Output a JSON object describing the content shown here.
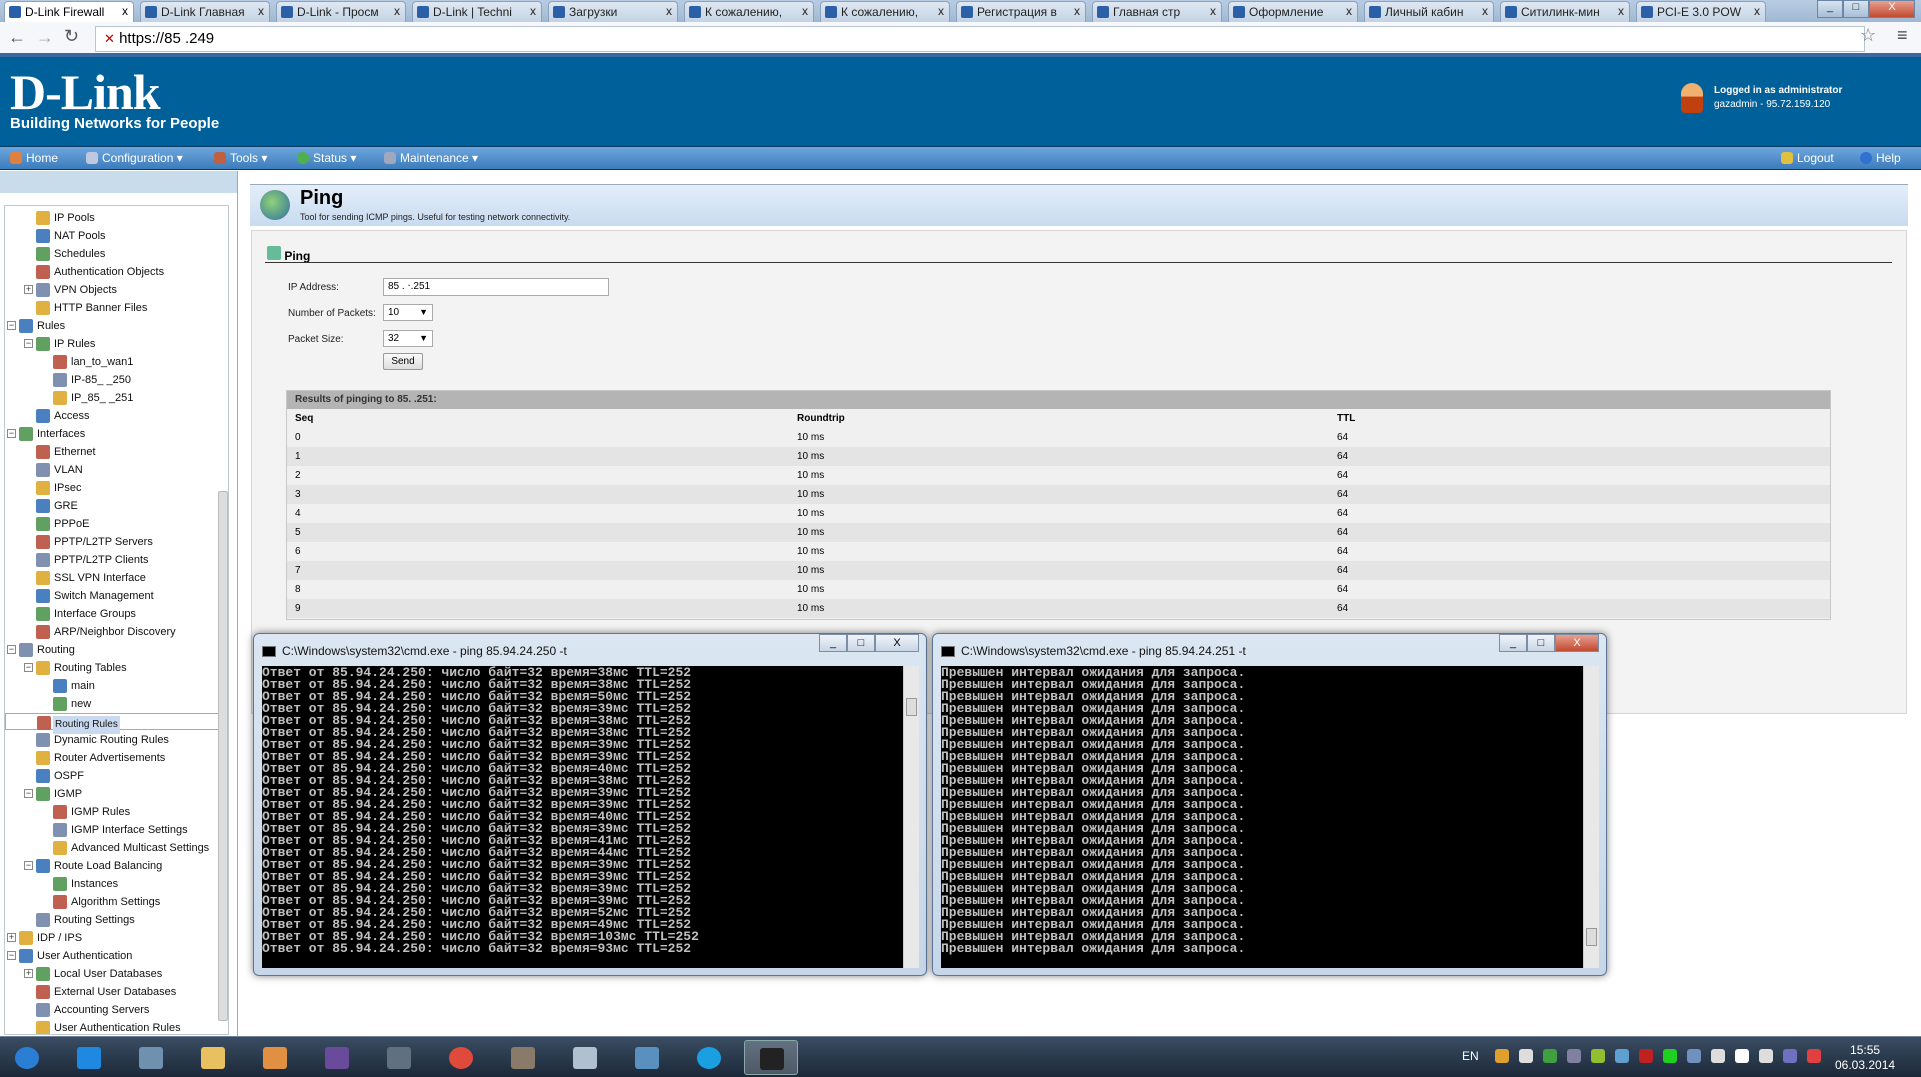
{
  "browser": {
    "tabs": [
      "D-Link Firewall",
      "D-Link Главная",
      "D-Link - Просм",
      "D-Link | Techni",
      "Загрузки",
      "К сожалению,",
      "К сожалению,",
      "Регистрация в",
      "Главная стр",
      "Оформление",
      "Личный кабин",
      "Ситилинк-мин",
      "PCI-E 3.0 POW"
    ],
    "tab_close": "x",
    "address": "https://85        .249",
    "window_controls": [
      "_",
      "□",
      "X"
    ]
  },
  "header": {
    "logo": "D-Link",
    "logo_tagline": "Building Networks for People",
    "logged_in": "Logged in as administrator",
    "user_line": "gazadmin - 95.72.159.120"
  },
  "nav": {
    "items": [
      "Home",
      "Configuration ▾",
      "Tools ▾",
      "Status ▾",
      "Maintenance ▾"
    ],
    "logout": "Logout",
    "help": "Help"
  },
  "sidebar": {
    "items": [
      {
        "label": "IP Pools",
        "level": 2
      },
      {
        "label": "NAT Pools",
        "level": 2
      },
      {
        "label": "Schedules",
        "level": 2
      },
      {
        "label": "Authentication Objects",
        "level": 2
      },
      {
        "label": "VPN Objects",
        "level": 2,
        "exp": "+"
      },
      {
        "label": "HTTP Banner Files",
        "level": 2
      },
      {
        "label": "Rules",
        "level": 1,
        "exp": "-"
      },
      {
        "label": "IP Rules",
        "level": 2,
        "exp": "-"
      },
      {
        "label": "lan_to_wan1",
        "level": 3
      },
      {
        "label": "IP-85_      _250",
        "level": 3
      },
      {
        "label": "IP_85_      _251",
        "level": 3
      },
      {
        "label": "Access",
        "level": 2
      },
      {
        "label": "Interfaces",
        "level": 1,
        "exp": "-"
      },
      {
        "label": "Ethernet",
        "level": 2
      },
      {
        "label": "VLAN",
        "level": 2
      },
      {
        "label": "IPsec",
        "level": 2
      },
      {
        "label": "GRE",
        "level": 2
      },
      {
        "label": "PPPoE",
        "level": 2
      },
      {
        "label": "PPTP/L2TP Servers",
        "level": 2
      },
      {
        "label": "PPTP/L2TP Clients",
        "level": 2
      },
      {
        "label": "SSL VPN Interface",
        "level": 2
      },
      {
        "label": "Switch Management",
        "level": 2
      },
      {
        "label": "Interface Groups",
        "level": 2
      },
      {
        "label": "ARP/Neighbor Discovery",
        "level": 2
      },
      {
        "label": "Routing",
        "level": 1,
        "exp": "-"
      },
      {
        "label": "Routing Tables",
        "level": 2,
        "exp": "-"
      },
      {
        "label": "main",
        "level": 3
      },
      {
        "label": "new",
        "level": 3
      },
      {
        "label": "Routing Rules",
        "level": 2,
        "selected": true
      },
      {
        "label": "Dynamic Routing Rules",
        "level": 2
      },
      {
        "label": "Router Advertisements",
        "level": 2
      },
      {
        "label": "OSPF",
        "level": 2
      },
      {
        "label": "IGMP",
        "level": 2,
        "exp": "-"
      },
      {
        "label": "IGMP Rules",
        "level": 3
      },
      {
        "label": "IGMP Interface Settings",
        "level": 3
      },
      {
        "label": "Advanced Multicast Settings",
        "level": 3
      },
      {
        "label": "Route Load Balancing",
        "level": 2,
        "exp": "-"
      },
      {
        "label": "Instances",
        "level": 3
      },
      {
        "label": "Algorithm Settings",
        "level": 3
      },
      {
        "label": "Routing Settings",
        "level": 2
      },
      {
        "label": "IDP / IPS",
        "level": 1,
        "exp": "+"
      },
      {
        "label": "User Authentication",
        "level": 1,
        "exp": "-"
      },
      {
        "label": "Local User Databases",
        "level": 2,
        "exp": "+"
      },
      {
        "label": "External User Databases",
        "level": 2
      },
      {
        "label": "Accounting Servers",
        "level": 2
      },
      {
        "label": "User Authentication Rules",
        "level": 2
      }
    ]
  },
  "page": {
    "title": "Ping",
    "description": "Tool for sending ICMP pings. Useful for testing network connectivity.",
    "section": "Ping",
    "ip_label": "IP Address:",
    "ip_value": "85    .    ‧.251",
    "packets_label": "Number of Packets:",
    "packets_value": "10",
    "size_label": "Packet Size:",
    "size_value": "32",
    "send": "Send",
    "arrow": "▼",
    "results_title": "Results of pinging to 85.        .251:",
    "columns": [
      "Seq",
      "Roundtrip",
      "TTL"
    ],
    "rows": [
      [
        "0",
        "10 ms",
        "64"
      ],
      [
        "1",
        "10 ms",
        "64"
      ],
      [
        "2",
        "10 ms",
        "64"
      ],
      [
        "3",
        "10 ms",
        "64"
      ],
      [
        "4",
        "10 ms",
        "64"
      ],
      [
        "5",
        "10 ms",
        "64"
      ],
      [
        "6",
        "10 ms",
        "64"
      ],
      [
        "7",
        "10 ms",
        "64"
      ],
      [
        "8",
        "10 ms",
        "64"
      ],
      [
        "9",
        "10 ms",
        "64"
      ]
    ]
  },
  "cmd_left": {
    "title": "C:\\Windows\\system32\\cmd.exe - ping  85.94.24.250 -t",
    "prefix": "Ответ от 85.94.24.250: число байт=32 время=",
    "suffix": "мс TTL=252",
    "times": [
      "38",
      "38",
      "50",
      "39",
      "38",
      "38",
      "39",
      "39",
      "40",
      "38",
      "39",
      "39",
      "40",
      "39",
      "41",
      "44",
      "39",
      "39",
      "39",
      "39",
      "52",
      "49",
      "103",
      "93"
    ]
  },
  "cmd_right": {
    "title": "C:\\Windows\\system32\\cmd.exe - ping  85.94.24.251 -t",
    "line": "Превышен интервал ожидания для запроса.",
    "count": 24
  },
  "taskbar": {
    "lang": "EN",
    "time": "15:55",
    "date": "06.03.2014",
    "apps": [
      "start",
      "internet-explorer",
      "file-manager",
      "explorer",
      "media-player",
      "visual-studio",
      "document-viewer",
      "chrome",
      "archive",
      "calculator",
      "remote-desktop",
      "skype",
      "command-prompt"
    ],
    "colors": [
      "#2a7fd4",
      "#1f88e0",
      "#7090b0",
      "#e8c060",
      "#e09040",
      "#6a4a9a",
      "#607080",
      "#e04a3a",
      "#8a7a6a",
      "#b0c0d0",
      "#5a90c0",
      "#1aa0e0",
      "#222222"
    ]
  }
}
